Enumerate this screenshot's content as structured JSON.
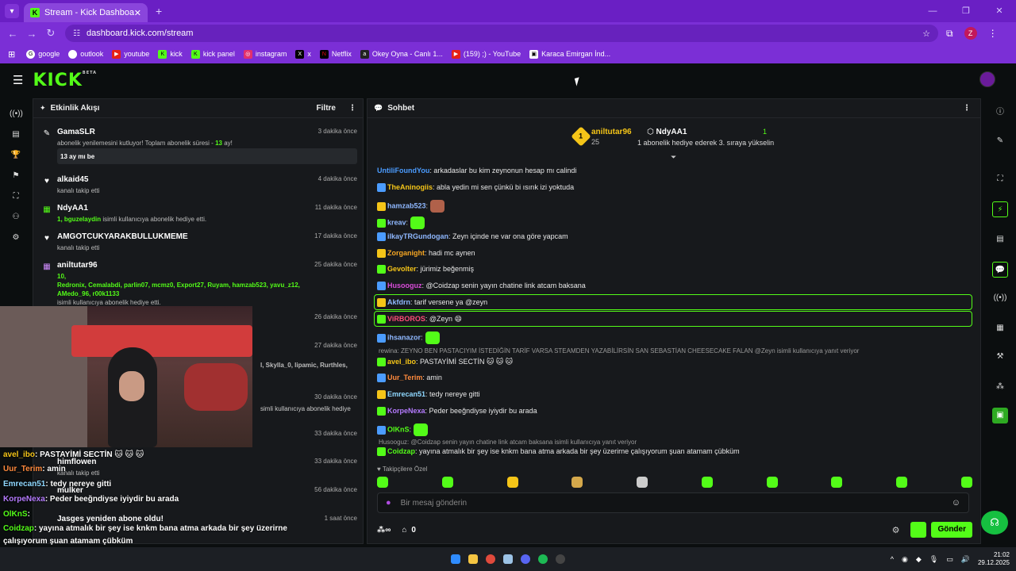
{
  "browser": {
    "tab_title": "Stream - Kick Dashboard",
    "url": "dashboard.kick.com/stream",
    "profile_letter": "Z",
    "bookmarks": [
      "google",
      "outlook",
      "youtube",
      "kick",
      "kick panel",
      "instagram",
      "x",
      "Netflix",
      "Okey Oyna - Canlı 1...",
      "(159) ;) - YouTube",
      "Karaca Emirgan İnd..."
    ]
  },
  "kick": {
    "logo": "KICK",
    "beta": "BETA"
  },
  "events": {
    "title": "Etkinlik Akışı",
    "filter": "Filtre",
    "items": [
      {
        "name": "GamaSLR",
        "time": "3 dakika önce",
        "desc": "abonelik yenilemesini kutluyor! Toplam abonelik süresi - ",
        "months": "13",
        "desc_end": " ay!",
        "message": "13 ay mı be"
      },
      {
        "name": "alkaid45",
        "time": "4 dakika önce",
        "desc": "kanalı takip etti"
      },
      {
        "name": "NdyAA1",
        "time": "11 dakika önce",
        "prefix": "1, ",
        "gifted": "bguzelaydin",
        "desc": " isimli kullanıcıya abonelik hediye etti."
      },
      {
        "name": "AMGOTCUKYARAKBULLUKMEME",
        "time": "17 dakika önce",
        "desc": "kanalı takip etti"
      },
      {
        "name": "aniltutar96",
        "time": "25 dakika önce",
        "count": "10,",
        "gifted": "Redronix, Cemalabdi, parlin07, mcmz0, Export27, Ruyam, hamzab523, yavu_z12, AMedo_96, r00k1133",
        "desc": "isimli kullanıcıya abonelik hediye etti."
      },
      {
        "time": "26 dakika önce"
      },
      {
        "time": "27 dakika önce",
        "partial": "l, Skylla_0, lipamic, Rurthles,"
      },
      {
        "time": "30 dakika önce",
        "partial": "simli kullanıcıya abonelik hediye"
      },
      {
        "time": "33 dakika önce"
      },
      {
        "name": "himflowen",
        "time": "33 dakika önce",
        "desc": "kanalı takip etti"
      },
      {
        "name": "mulker",
        "time": "56 dakika önce"
      },
      {
        "name": "Jasges yeniden abone oldu!",
        "time": "1 saat önce"
      }
    ]
  },
  "chat": {
    "title": "Sohbet",
    "pinned": {
      "user1": "aniltutar96",
      "count1": "25",
      "rank1": "1",
      "user2": "NdyAA1",
      "count2": "1",
      "desc2": "1 abonelik hediye ederek 3. sıraya yükselin"
    },
    "lines": [
      {
        "user": "UntiliFoundYou",
        "color": "#4b9cff",
        "text": ": arkadaslar bu kim zeynonun hesap mı calindi"
      },
      {
        "user": "TheAninogiis",
        "color": "#f5c518",
        "text": ": abla yedin mi sen çünkü bi ısırık izi yoktuda"
      },
      {
        "user": "hamzab523",
        "color": "#8fb8ff",
        "text": ":"
      },
      {
        "user": "kreav",
        "color": "#8fb8ff",
        "text": ":"
      },
      {
        "user": "ilkayTRGundogan",
        "color": "#8fb8ff",
        "text": ": Zeyn içinde ne var ona göre yapcam"
      },
      {
        "user": "Zorganight",
        "color": "#f5a623",
        "text": ": hadi mc aynen"
      },
      {
        "user": "Gevolter",
        "color": "#f5c518",
        "text": ": jürimiz beğenmiş"
      },
      {
        "user": "Husooguz",
        "color": "#d94cd9",
        "text": ": @Coidzap senin yayın chatine link atcam baksana"
      },
      {
        "user": "Akfdrn",
        "color": "#8fb8ff",
        "text": ": tarif versene ya @zeyn"
      },
      {
        "user": "ViRBOROS",
        "color": "#ff4d7a",
        "text": ": @Zeyn 😄"
      },
      {
        "user": "ihsanazor",
        "color": "#8fb8ff",
        "text": ":"
      },
      {
        "reply": "rewina: ZEYNO BEN PASTACIYIM İSTEDİĞİN TARİF VARSA STEAMDEN YAZABİLİRSİN SAN SEBASTİAN CHEESECAKE FALAN @Zeyn isimli kullanıcıya yanıt veriyor"
      },
      {
        "user": "avel_ibo",
        "color": "#f5c518",
        "text": ": PASTAYİMİ SECTİN 🐱 🐱 🐱"
      },
      {
        "user": "Uur_Terim",
        "color": "#ff8a3d",
        "text": ": amin"
      },
      {
        "user": "Emrecan51",
        "color": "#8fd8ff",
        "text": ": tedy nereye gitti"
      },
      {
        "user": "KorpeNexa",
        "color": "#b57bff",
        "text": ": Peder beeğndiyse iyiydir bu arada"
      },
      {
        "user": "OlKnS",
        "color": "#53fc18",
        "text": ":"
      },
      {
        "reply": "Husooguz: @Coidzap senin yayın chatine link atcam baksana isimli kullanıcıya yanıt veriyor"
      },
      {
        "user": "Coidzap",
        "color": "#53fc18",
        "text": ": yayına atmalık bir şey ise knkm bana atma arkada bir şey üzerirne çalışıyorum şuan atamam çübküm"
      }
    ],
    "followers_only": "Takipçilere Özel",
    "input_placeholder": "Bir mesaj gönderin",
    "viewer_count": "0",
    "send": "Gönder"
  },
  "overlay": {
    "lines": [
      {
        "user": "avel_ibo",
        "text": ": PASTAYİMİ SECTİN 🐱 🐱 🐱"
      },
      {
        "user": "Uur_Terim",
        "text": ": amin"
      },
      {
        "user": "Emrecan51",
        "text": ": tedy nereye gitti"
      },
      {
        "user": "KorpeNexa",
        "text": ": Peder beeğndiyse iyiydir bu arada"
      },
      {
        "user": "OlKnS",
        "text": ":"
      },
      {
        "user": "Coidzap",
        "text": ": yayına atmalık bir şey ise knkm bana atma arkada bir şey üzerirne"
      },
      {
        "user": "",
        "text": "çalışıyorum şuan atamam çübküm"
      }
    ]
  },
  "taskbar": {
    "time": "21:02",
    "date": "29.12.2025"
  },
  "colors": {
    "accent": "#53fc18",
    "chrome": "#7b2fd6",
    "panel": "#17191c"
  }
}
